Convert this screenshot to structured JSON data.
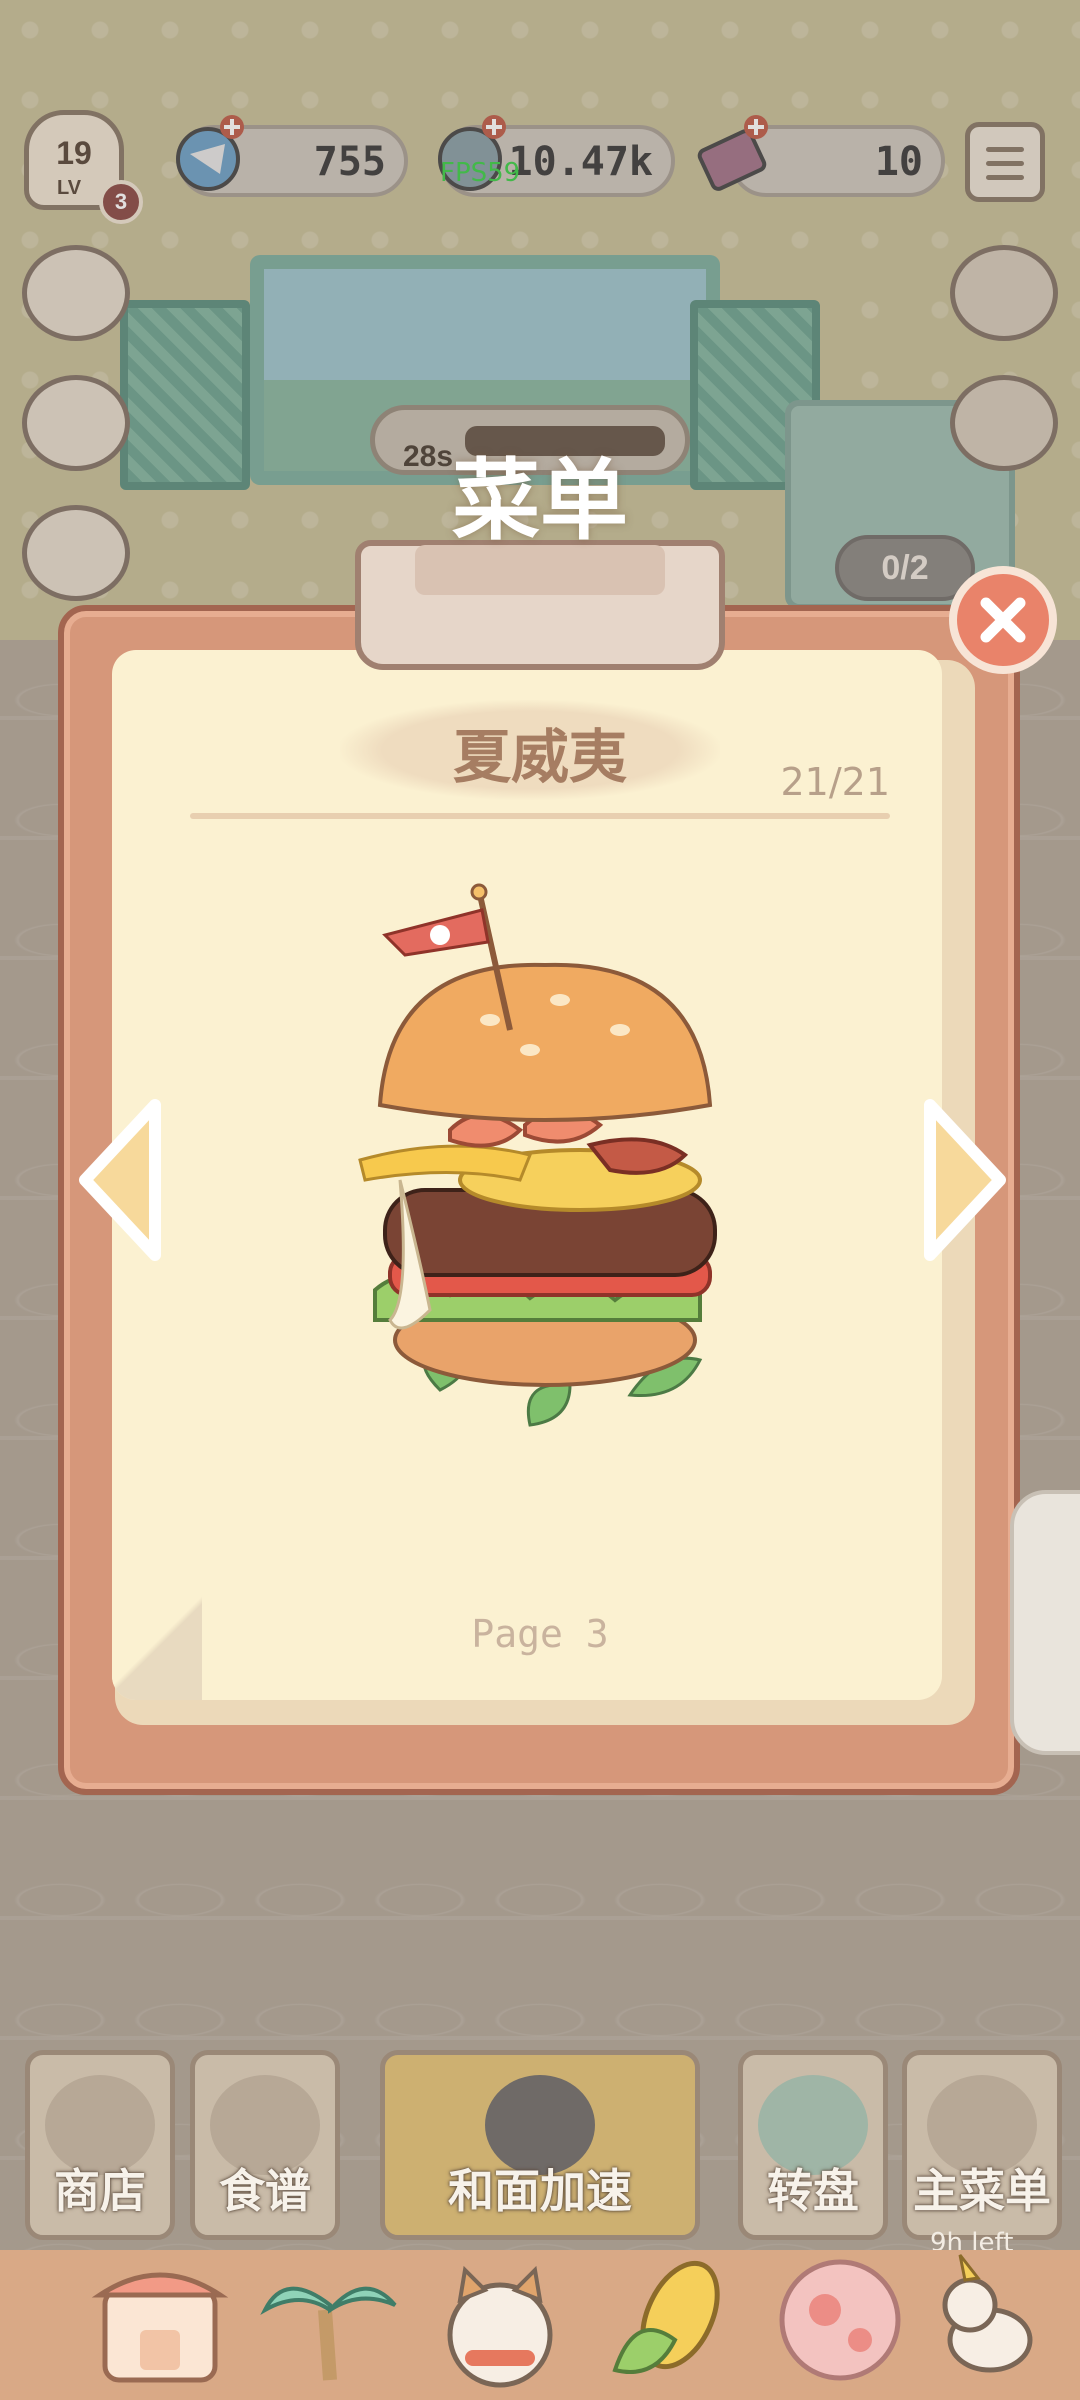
{
  "hud": {
    "level": "19",
    "level_text": "LV",
    "level_badge": "3",
    "gems": "755",
    "coins": "10.47k",
    "tickets": "10",
    "fps": "FPS59"
  },
  "scene": {
    "timer": "28s",
    "counter": "0/2"
  },
  "menu_dialog": {
    "title": "菜单",
    "recipe_name": "夏威夷",
    "recipe_count": "21/21",
    "page_label": "Page 3"
  },
  "bottom_bar": {
    "buttons": [
      {
        "label": "商店"
      },
      {
        "label": "食谱"
      },
      {
        "label": "和面加速"
      },
      {
        "label": "转盘"
      },
      {
        "label": "主菜单"
      }
    ],
    "time_left": "9h left"
  },
  "tabs": [
    {
      "icon": "shop-tab-icon"
    },
    {
      "icon": "palm-tree-tab-icon"
    },
    {
      "icon": "cat-tab-icon"
    },
    {
      "icon": "corn-tab-icon"
    },
    {
      "icon": "flower-tab-icon"
    },
    {
      "icon": "unicorn-tab-icon"
    }
  ],
  "colors": {
    "board": "#d6977a",
    "paper": "#fbf1d1",
    "accent_close": "#e9836a",
    "recipe_text": "#a67d62"
  }
}
